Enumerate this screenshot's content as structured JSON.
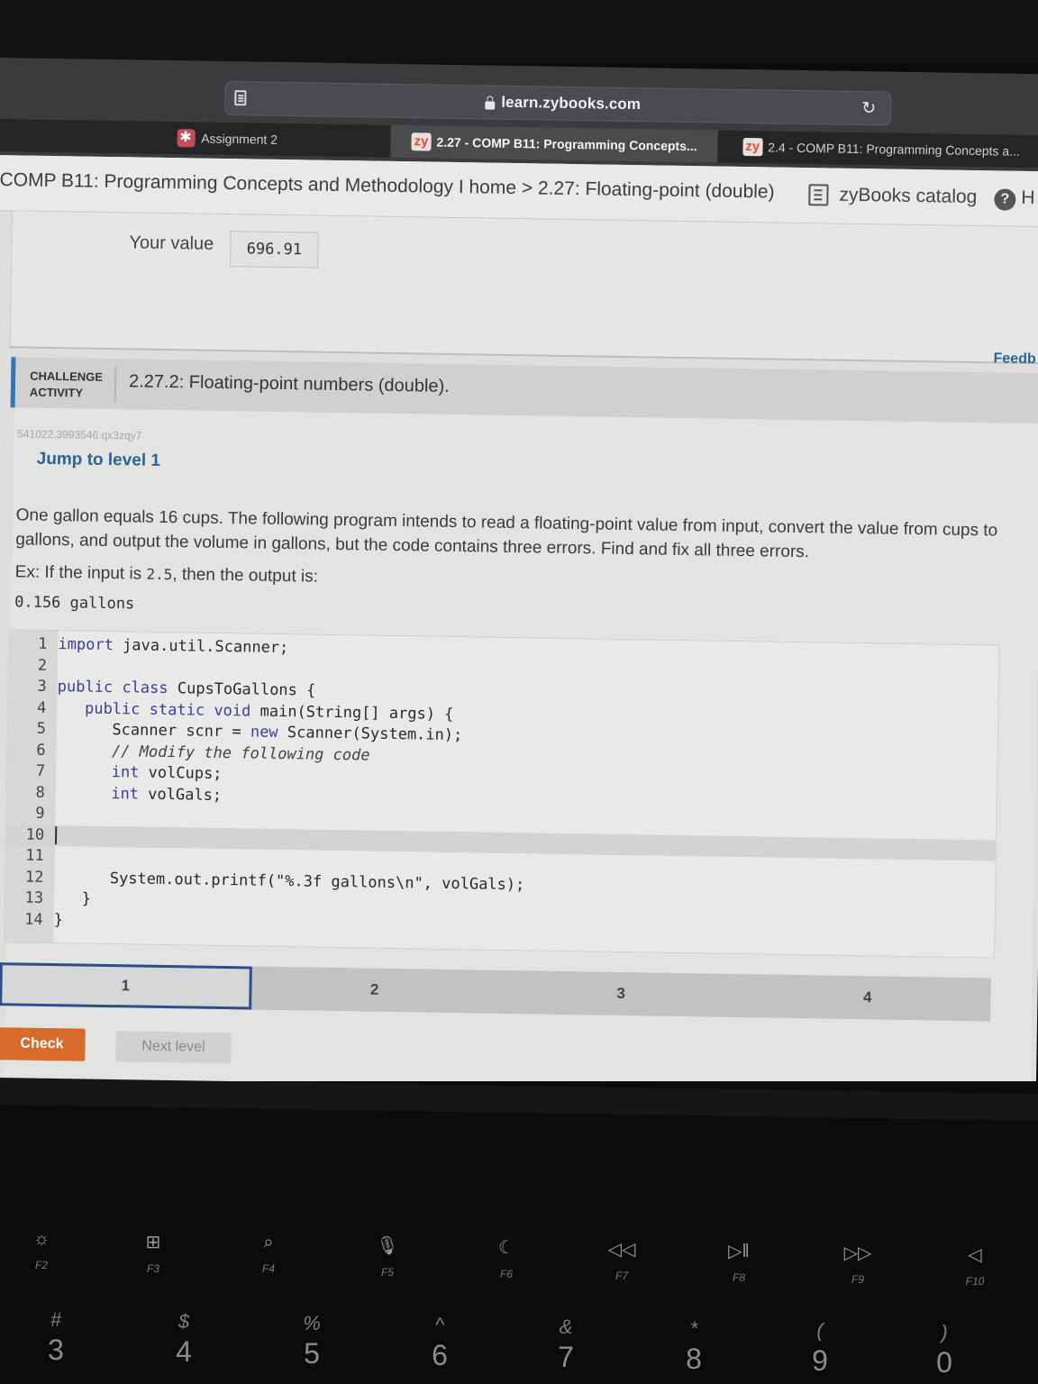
{
  "browser": {
    "url": "learn.zybooks.com",
    "tabs": [
      {
        "label": "",
        "icon": "none"
      },
      {
        "label": "Assignment 2",
        "icon": "canvas-favicon"
      },
      {
        "label": "2.27 - COMP B11: Programming Concepts...",
        "icon": "zybooks-favicon",
        "active": true
      },
      {
        "label": "2.4 - COMP B11: Programming Concepts a...",
        "icon": "zybooks-favicon"
      }
    ],
    "zy_favicon_text": "zy"
  },
  "topnav": {
    "breadcrumb_course": "COMP B11: Programming Concepts and Methodology I home",
    "breadcrumb_sep": " > ",
    "breadcrumb_section": "2.27: Floating-point (double)",
    "catalog_label": "zyBooks catalog",
    "help_symbol": "?",
    "help_label": "H"
  },
  "prev_activity": {
    "your_value_label": "Your value",
    "your_value": "696.91",
    "feedback_label": "Feedb"
  },
  "challenge": {
    "tag_line1": "CHALLENGE",
    "tag_line2": "ACTIVITY",
    "title": "2.27.2: Floating-point numbers (double).",
    "activity_id": "541022.3993546.qx3zqy7",
    "jump_link": "Jump to level 1",
    "prompt": "One gallon equals 16 cups. The following program intends to read a floating-point value from input, convert the value from cups to gallons, and output the volume in gallons, but the code contains three errors. Find and fix all three errors.",
    "example_prefix": "Ex: If the input is ",
    "example_input": "2.5",
    "example_suffix": ", then the output is:",
    "example_output": "0.156 gallons",
    "code_lines": [
      {
        "n": "1",
        "text": "import java.util.Scanner;"
      },
      {
        "n": "2",
        "text": ""
      },
      {
        "n": "3",
        "text": "public class CupsToGallons {"
      },
      {
        "n": "4",
        "text": "   public static void main(String[] args) {"
      },
      {
        "n": "5",
        "text": "      Scanner scnr = new Scanner(System.in);"
      },
      {
        "n": "6",
        "text": "      // Modify the following code"
      },
      {
        "n": "7",
        "text": "      int volCups;"
      },
      {
        "n": "8",
        "text": "      int volGals;"
      },
      {
        "n": "9",
        "text": ""
      },
      {
        "n": "10",
        "text": ""
      },
      {
        "n": "11",
        "text": ""
      },
      {
        "n": "12",
        "text": "      System.out.printf(\"%.3f gallons\\n\", volGals);"
      },
      {
        "n": "13",
        "text": "   }"
      },
      {
        "n": "14",
        "text": "}"
      }
    ],
    "levels": [
      "1",
      "2",
      "3",
      "4"
    ],
    "current_level": "1",
    "check_label": "Check",
    "next_label": "Next level"
  },
  "keyboard": {
    "fkeys": [
      {
        "icon": "☼",
        "label": "F2",
        "name": "brightness-icon"
      },
      {
        "icon": "⊞",
        "label": "F3",
        "name": "mission-control-icon"
      },
      {
        "icon": "⌕",
        "label": "F4",
        "name": "search-icon"
      },
      {
        "icon": "🎙",
        "label": "F5",
        "name": "microphone-icon"
      },
      {
        "icon": "☾",
        "label": "F6",
        "name": "moon-icon"
      },
      {
        "icon": "◁◁",
        "label": "F7",
        "name": "rewind-icon"
      },
      {
        "icon": "▷‖",
        "label": "F8",
        "name": "play-pause-icon"
      },
      {
        "icon": "▷▷",
        "label": "F9",
        "name": "fast-forward-icon"
      },
      {
        "icon": "◁",
        "label": "F10",
        "name": "mute-icon"
      }
    ],
    "numkeys": [
      {
        "sym": "#",
        "num": "3"
      },
      {
        "sym": "$",
        "num": "4"
      },
      {
        "sym": "%",
        "num": "5"
      },
      {
        "sym": "^",
        "num": "6"
      },
      {
        "sym": "&",
        "num": "7"
      },
      {
        "sym": "*",
        "num": "8"
      },
      {
        "sym": "(",
        "num": "9"
      },
      {
        "sym": ")",
        "num": "0"
      }
    ]
  },
  "colors": {
    "accent_blue": "#2f76b8",
    "link_blue": "#2a6496",
    "check_orange": "#d86a2a",
    "level_border": "#2c4f8c"
  }
}
